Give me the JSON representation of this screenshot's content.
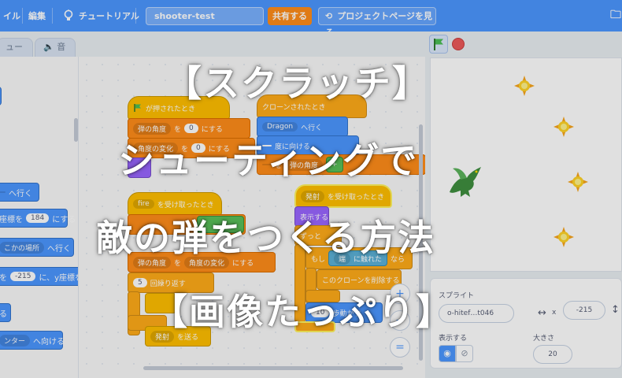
{
  "menubar": {
    "file_label": "イル",
    "edit_label": "編集",
    "tutorial_label": "チュートリアル",
    "project_title": "shooter-test",
    "share_label": "共有する",
    "project_page_label": "プロジェクトページを見る"
  },
  "tabs": {
    "costume_label": "ューム",
    "sound_label": "音"
  },
  "palette": {
    "goto_label": "へ行く",
    "set_y_label": "座標を",
    "set_y_value": "184",
    "set_y_suffix": "にする",
    "goto_random_label": "こかの場所",
    "goto_random_suffix": "へ行く",
    "glide_value": "-215",
    "glide_suffix": "に、y座標を",
    "point_label": "ンター",
    "point_suffix": "へ向ける",
    "line_label": "る"
  },
  "scripts": {
    "flag_hat": "が押されたとき",
    "set_angle_label": "弾の角度",
    "set_to": "を",
    "set_angle_value": "0",
    "set_suffix": "にする",
    "set_change_label": "角度の変化",
    "set_change_value": "0",
    "fire_receive": "fire",
    "receive_suffix": "を受け取ったとき",
    "angle2_label": "弾の角度",
    "angle2_mid": "を",
    "angle2_var": "角度の変化",
    "angle2_suffix": "にする",
    "repeat_count": "5",
    "repeat_label": "回繰り返す",
    "send_label": "発射",
    "send_suffix": "を送る",
    "clone_hat": "クローンされたとき",
    "goto_sprite": "Dragon",
    "goto_suffix": "へ行く",
    "point_dir_suffix": "度に向ける",
    "angle_var": "弾の角度",
    "plus_op": "+",
    "shoot_receive": "発射",
    "shoot_receive_suffix": "を受け取ったとき",
    "show_label": "表示する",
    "forever_label": "ずっと",
    "if_label": "もし",
    "touching_target": "端",
    "touching_suffix": "に触れた",
    "then_label": "なら",
    "delete_clone": "このクローンを削除する",
    "move_steps": "10",
    "move_suffix": "歩動かす"
  },
  "code_area": {
    "zoom_reset_label": "="
  },
  "sprite_info": {
    "sprite_label": "スプライト",
    "sprite_name": "o-hitef…t046",
    "x_label": "x",
    "x_value": "-215",
    "show_label": "表示する",
    "size_label": "大きさ",
    "size_value": "20"
  },
  "title_overlay": {
    "line1": "【スクラッチ】",
    "line2": "シューティングで",
    "line3": "敵の弾をつくる方法",
    "line4": "【画像たっぷり】"
  },
  "colors": {
    "menubar": "#4c97ff",
    "motion": "#4c97ff",
    "variables": "#ff8c1a",
    "events": "#ffbf00",
    "control": "#ffab19",
    "operators": "#59c059",
    "sensing": "#5cb1d6",
    "looks": "#9966ff"
  }
}
